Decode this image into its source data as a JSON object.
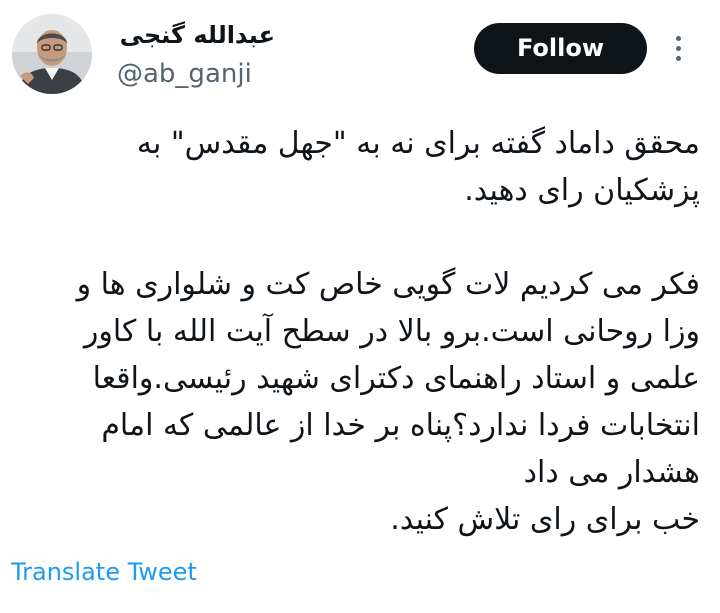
{
  "author": {
    "display_name": "عبدالله گنجی",
    "handle": "@ab_ganji",
    "avatar_icon": "user-avatar-photo"
  },
  "actions": {
    "follow_label": "Follow",
    "more_icon": "more-vertical-icon"
  },
  "tweet": {
    "paragraphs": [
      [
        "محقق داماد گفته برای نه به \"جهل مقدس\" به",
        "پزشکیان رای دهید."
      ],
      [
        "فکر می کردیم لات گویی خاص کت و شلواری ها و",
        "وزا روحانی است.برو بالا در سطح آیت الله با کاور",
        "علمی و استاد راهنمای دکترای شهید رئیسی.واقعا",
        "انتخابات فردا ندارد؟پناه بر خدا از عالمی که امام",
        "هشدار می داد",
        "خب برای رای تلاش کنید."
      ]
    ]
  },
  "translate_label": "Translate Tweet",
  "colors": {
    "text": "#0f1419",
    "secondary": "#536471",
    "link": "#1d9bf0",
    "follow_bg": "#0f1419",
    "follow_text": "#ffffff"
  }
}
